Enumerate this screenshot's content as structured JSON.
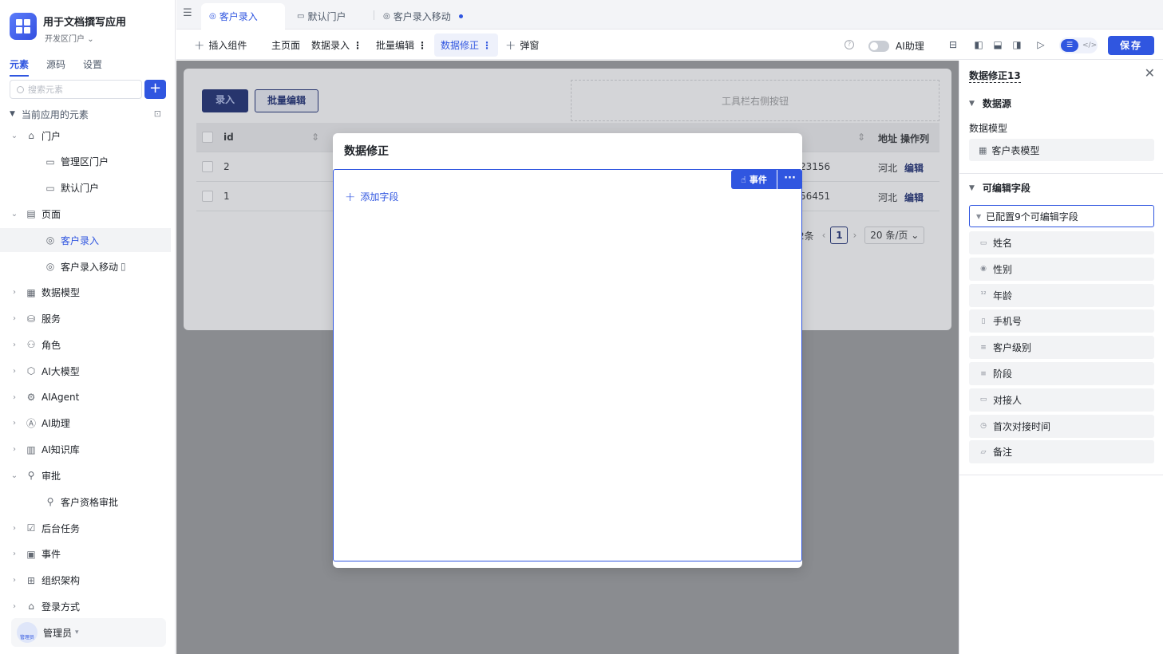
{
  "app": {
    "title": "用于文档撰写应用",
    "env": "开发区门户"
  },
  "sidebar": {
    "tabs": [
      "元素",
      "源码",
      "设置"
    ],
    "search_placeholder": "搜索元素",
    "add_label": "+",
    "tree_title": "当前应用的元素",
    "items": [
      {
        "label": "门户",
        "icon": "home-icon",
        "arrow": "⌄"
      },
      {
        "label": "管理区门户",
        "icon": "portal-icon",
        "arrow": ""
      },
      {
        "label": "默认门户",
        "icon": "portal-icon",
        "arrow": ""
      },
      {
        "label": "页面",
        "icon": "page-icon",
        "arrow": "⌄"
      },
      {
        "label": "客户录入",
        "icon": "page-edit-icon",
        "arrow": ""
      },
      {
        "label": "客户录入移动",
        "icon": "page-edit-icon",
        "arrow": ""
      },
      {
        "label": "数据模型",
        "icon": "table-icon",
        "arrow": "›"
      },
      {
        "label": "服务",
        "icon": "service-icon",
        "arrow": "›"
      },
      {
        "label": "角色",
        "icon": "role-icon",
        "arrow": "›"
      },
      {
        "label": "AI大模型",
        "icon": "model-icon",
        "arrow": "›"
      },
      {
        "label": "AIAgent",
        "icon": "robot-icon",
        "arrow": "›"
      },
      {
        "label": "AI助理",
        "icon": "ai-icon",
        "arrow": "›"
      },
      {
        "label": "AI知识库",
        "icon": "book-icon",
        "arrow": "›"
      },
      {
        "label": "审批",
        "icon": "stamp-icon",
        "arrow": "⌄"
      },
      {
        "label": "客户资格审批",
        "icon": "stamp-icon",
        "arrow": ""
      },
      {
        "label": "后台任务",
        "icon": "task-icon",
        "arrow": "›"
      },
      {
        "label": "事件",
        "icon": "event-icon",
        "arrow": "›"
      },
      {
        "label": "组织架构",
        "icon": "org-icon",
        "arrow": "›"
      },
      {
        "label": "登录方式",
        "icon": "login-icon",
        "arrow": "›"
      }
    ],
    "user": {
      "name": "管理员",
      "avatar_text": "管理员"
    }
  },
  "tabs": [
    {
      "label": "客户录入"
    },
    {
      "label": "默认门户"
    },
    {
      "label": "客户录入移动"
    }
  ],
  "toolbar": {
    "insert": "插入组件",
    "items": [
      "主页面",
      "数据录入",
      "批量编辑",
      "数据修正"
    ],
    "popup": "弹窗",
    "help": "?",
    "ai_label": "AI助理",
    "save": "保存"
  },
  "canvas": {
    "btn_entry": "录入",
    "btn_batch": "批量编辑",
    "right_buttons": "工具栏右侧按钮",
    "columns": [
      "id",
      "地址",
      "操作列"
    ],
    "rows": [
      {
        "id": "2",
        "phone_tail": "23156",
        "addr": "河北",
        "action": "编辑"
      },
      {
        "id": "1",
        "phone_tail": "56451",
        "addr": "河北",
        "action": "编辑"
      }
    ],
    "pager": {
      "total": "2条",
      "page": "1",
      "size": "20 条/页"
    }
  },
  "modal": {
    "title": "数据修正",
    "event_btn": "事件",
    "more_btn": "···",
    "add_field": "添加字段"
  },
  "rpanel": {
    "title": "数据修正13",
    "section_datasource": "数据源",
    "model_label": "数据模型",
    "model_value": "客户表模型",
    "section_fields": "可编辑字段",
    "fields_summary": "已配置9个可编辑字段",
    "fields": [
      {
        "label": "姓名",
        "icon": "▭"
      },
      {
        "label": "性别",
        "icon": "◉"
      },
      {
        "label": "年龄",
        "icon": "¹²"
      },
      {
        "label": "手机号",
        "icon": "▯"
      },
      {
        "label": "客户级别",
        "icon": "≡"
      },
      {
        "label": "阶段",
        "icon": "≡"
      },
      {
        "label": "对接人",
        "icon": "▭"
      },
      {
        "label": "首次对接时间",
        "icon": "◷"
      },
      {
        "label": "备注",
        "icon": "▱"
      }
    ]
  }
}
